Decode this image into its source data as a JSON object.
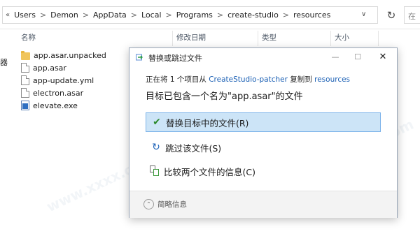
{
  "address_bar": {
    "overflow": "«",
    "crumbs": [
      "Users",
      "Demon",
      "AppData",
      "Local",
      "Programs",
      "create-studio",
      "resources"
    ],
    "separator": ">",
    "dropdown": "∨",
    "refresh": "↻",
    "search_stub": "在"
  },
  "nav_stub": "器",
  "columns": {
    "name": "名称",
    "modified": "修改日期",
    "type": "类型",
    "size": "大小"
  },
  "files": [
    {
      "name": "app.asar.unpacked",
      "icon": "folder-icon"
    },
    {
      "name": "app.asar",
      "icon": "file-icon"
    },
    {
      "name": "app-update.yml",
      "icon": "file-icon"
    },
    {
      "name": "electron.asar",
      "icon": "file-icon"
    },
    {
      "name": "elevate.exe",
      "icon": "exe-icon"
    }
  ],
  "dialog": {
    "title": "替换或跳过文件",
    "minimize": "—",
    "maximize": "☐",
    "close": "✕",
    "copy_prefix": "正在将 1 个项目从",
    "source": "CreateStudio-patcher",
    "copy_mid": "复制到",
    "destination": "resources",
    "heading": "目标已包含一个名为\"app.asar\"的文件",
    "options": [
      {
        "label": "替换目标中的文件(R)",
        "icon": "check-icon",
        "selected": true
      },
      {
        "label": "跳过该文件(S)",
        "icon": "skip-icon",
        "selected": false
      },
      {
        "label": "比较两个文件的信息(C)",
        "icon": "compare-icon",
        "selected": false
      }
    ],
    "details_label": "简略信息",
    "details_icon": "⌃"
  },
  "colors": {
    "selection": "#cce4f7",
    "selection_border": "#7eb4ea",
    "link": "#1a5fb4",
    "check": "#2d8a2d",
    "skip": "#1e63b8"
  }
}
